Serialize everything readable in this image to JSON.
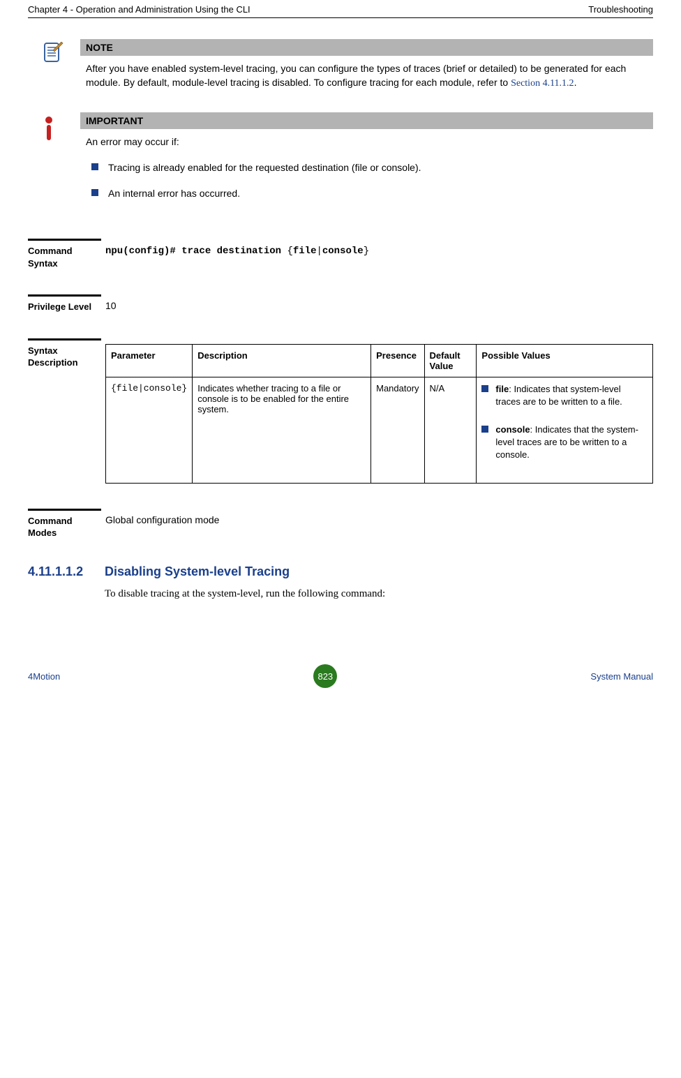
{
  "header": {
    "left": "Chapter 4 - Operation and Administration Using the CLI",
    "right": "Troubleshooting"
  },
  "note": {
    "title": "NOTE",
    "text_before_link": "After you have enabled system-level tracing, you can configure the types of traces (brief or detailed) to be generated for each module. By default, module-level tracing is disabled. To configure tracing for each module, refer to ",
    "link_text": "Section 4.11.1.2",
    "text_after_link": "."
  },
  "important": {
    "title": "IMPORTANT",
    "intro": "An error may occur if:",
    "bullets": [
      "Tracing is already enabled for the requested destination (file or console).",
      "An internal error has occurred."
    ]
  },
  "command_syntax": {
    "label": "Command Syntax",
    "value_prefix": "npu(config)# trace destination ",
    "value_braced": "{file|console}"
  },
  "privilege_level": {
    "label": "Privilege Level",
    "value": "10"
  },
  "syntax_description": {
    "label": "Syntax Description",
    "headers": {
      "parameter": "Parameter",
      "description": "Description",
      "presence": "Presence",
      "default_value": "Default Value",
      "possible_values": "Possible Values"
    },
    "row": {
      "parameter": "{file|console}",
      "description": "Indicates whether tracing to a file or console is to be enabled for the entire system.",
      "presence": "Mandatory",
      "default_value": "N/A",
      "possible_values": [
        {
          "bold": "file",
          "rest": ": Indicates that system-level traces are to be written to a file."
        },
        {
          "bold": "console",
          "rest": ": Indicates that the system-level traces are to be written to a console."
        }
      ]
    }
  },
  "command_modes": {
    "label": "Command Modes",
    "value": "Global configuration mode"
  },
  "subsection": {
    "number": "4.11.1.1.2",
    "title": "Disabling System-level Tracing",
    "body": "To disable tracing at the system-level, run the following command:"
  },
  "footer": {
    "left": "4Motion",
    "page": "823",
    "right": "System Manual"
  }
}
